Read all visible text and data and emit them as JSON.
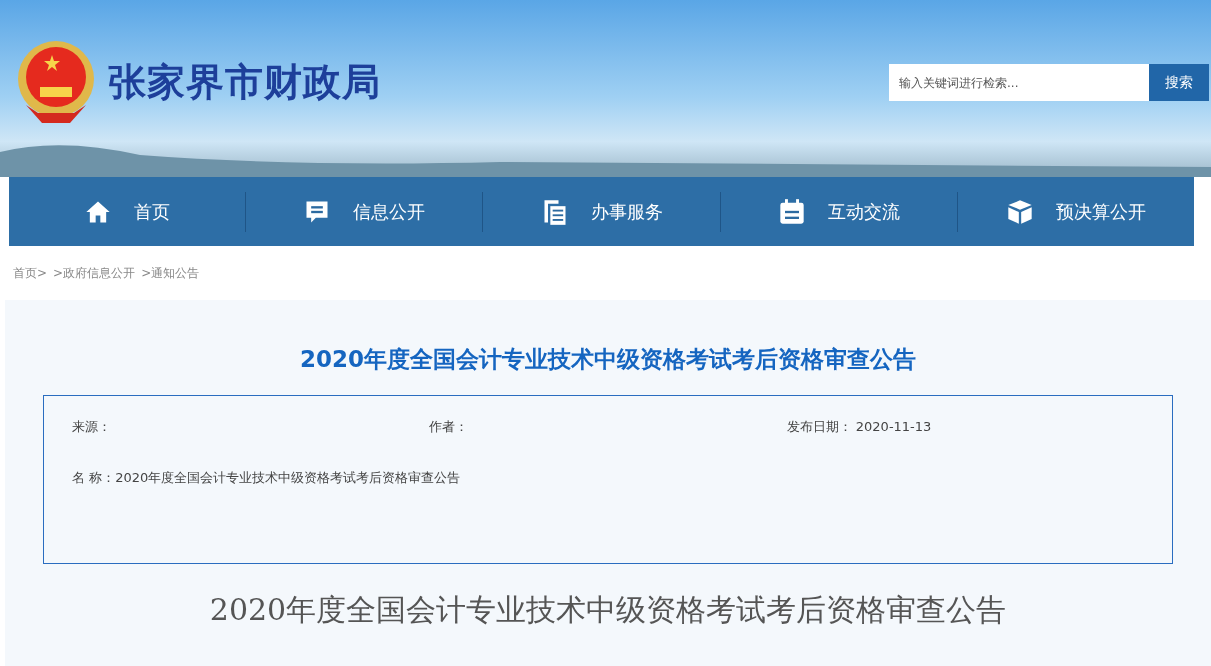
{
  "header": {
    "site_title": "张家界市财政局",
    "search": {
      "placeholder": "输入关键词进行检索...",
      "button": "搜索"
    }
  },
  "nav": [
    {
      "label": "首页",
      "kind": "home"
    },
    {
      "label": "信息公开",
      "kind": "message"
    },
    {
      "label": "办事服务",
      "kind": "pages"
    },
    {
      "label": "互动交流",
      "kind": "calendar"
    },
    {
      "label": "预决算公开",
      "kind": "box"
    }
  ],
  "breadcrumb": [
    "首页>",
    ">政府信息公开",
    ">通知公告"
  ],
  "article": {
    "title": "2020年度全国会计专业技术中级资格考试考后资格审查公告",
    "meta": {
      "source_label": "来源：",
      "author_label": "作者：",
      "date_label": "发布日期：",
      "date": "2020-11-13"
    },
    "name_line": "名 称：2020年度全国会计专业技术中级资格考试考后资格审查公告",
    "body_title": "2020年度全国会计专业技术中级资格考试考后资格审查公告"
  }
}
